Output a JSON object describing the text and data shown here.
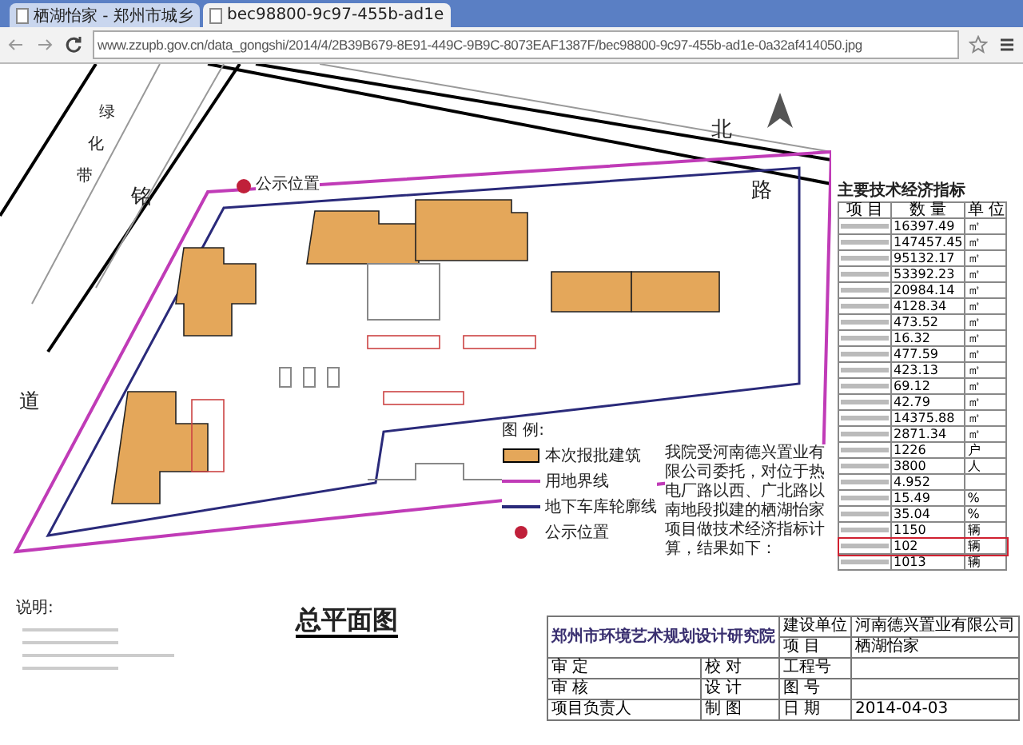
{
  "tabs": [
    {
      "label": "栖湖怡家 - 郑州市城乡",
      "selected": false
    },
    {
      "label": "bec98800-9c97-455b-ad1e",
      "selected": true
    }
  ],
  "address": "www.zzupb.gov.cn/data_gongshi/2014/4/2B39B679-8E91-449C-9B9C-8073EAF1387F/bec98800-9c97-455b-ad1e-0a32af414050.jpg",
  "plan": {
    "road_labels": [
      {
        "text": "绿",
        "kind": "green"
      },
      {
        "text": "化",
        "kind": "green"
      },
      {
        "text": "带",
        "kind": "green"
      },
      {
        "text": "铭",
        "kind": "road"
      },
      {
        "text": "道",
        "kind": "road"
      },
      {
        "text": "北",
        "kind": "road"
      },
      {
        "text": "路",
        "kind": "road"
      }
    ],
    "marker": "公示位置"
  },
  "legend": {
    "title": "图 例:",
    "items": [
      {
        "kind": "fill",
        "label": "本次报批建筑"
      },
      {
        "kind": "site",
        "label": "用地界线"
      },
      {
        "kind": "garage",
        "label": "地下车库轮廓线"
      },
      {
        "kind": "dot",
        "label": "公示位置"
      }
    ]
  },
  "description": "我院受河南德兴置业有限公司委托，对位于热电厂路以西、广北路以南地段拟建的栖湖怡家项目做技术经济指标计算，结果如下：",
  "table": {
    "title": "主要技术经济指标",
    "columns": [
      "项 目",
      "数 量",
      "单 位"
    ],
    "rows": [
      {
        "value": "16397.49",
        "unit": "㎡",
        "highlighted": false
      },
      {
        "value": "147457.45",
        "unit": "㎡",
        "highlighted": false
      },
      {
        "value": "95132.17",
        "unit": "㎡",
        "highlighted": false
      },
      {
        "value": "53392.23",
        "unit": "㎡",
        "highlighted": false
      },
      {
        "value": "20984.14",
        "unit": "㎡",
        "highlighted": false
      },
      {
        "value": "4128.34",
        "unit": "㎡",
        "highlighted": false
      },
      {
        "value": "473.52",
        "unit": "㎡",
        "highlighted": false
      },
      {
        "value": "16.32",
        "unit": "㎡",
        "highlighted": false
      },
      {
        "value": "477.59",
        "unit": "㎡",
        "highlighted": false
      },
      {
        "value": "423.13",
        "unit": "㎡",
        "highlighted": false
      },
      {
        "value": "69.12",
        "unit": "㎡",
        "highlighted": false
      },
      {
        "value": "42.79",
        "unit": "㎡",
        "highlighted": false
      },
      {
        "value": "14375.88",
        "unit": "㎡",
        "highlighted": false
      },
      {
        "value": "2871.34",
        "unit": "㎡",
        "highlighted": false
      },
      {
        "value": "1226",
        "unit": "户",
        "highlighted": false
      },
      {
        "value": "3800",
        "unit": "人",
        "highlighted": false
      },
      {
        "value": "4.952",
        "highlighted": false
      },
      {
        "value": "15.49",
        "unit": "%",
        "highlighted": false
      },
      {
        "value": "35.04",
        "unit": "%",
        "highlighted": false
      },
      {
        "value": "1150",
        "unit": "辆",
        "highlighted": false
      },
      {
        "value": "102",
        "unit": "辆",
        "highlighted": true
      },
      {
        "value": "1013",
        "unit": "辆",
        "highlighted": false
      }
    ]
  },
  "notes_title": "说明:",
  "drawing_title": "总平面图",
  "title_block": {
    "institute": "郑州市环境艺术规划设计研究院",
    "client_label": "建设单位",
    "client": "河南德兴置业有限公司",
    "project_label": "项 目",
    "project": "栖湖怡家",
    "cells": [
      [
        "审 定",
        "校 对",
        "工程号"
      ],
      [
        "审 核",
        "设 计",
        "图 号"
      ],
      [
        "项目负责人",
        "制 图",
        "日 期",
        "2014-04-03"
      ]
    ]
  }
}
